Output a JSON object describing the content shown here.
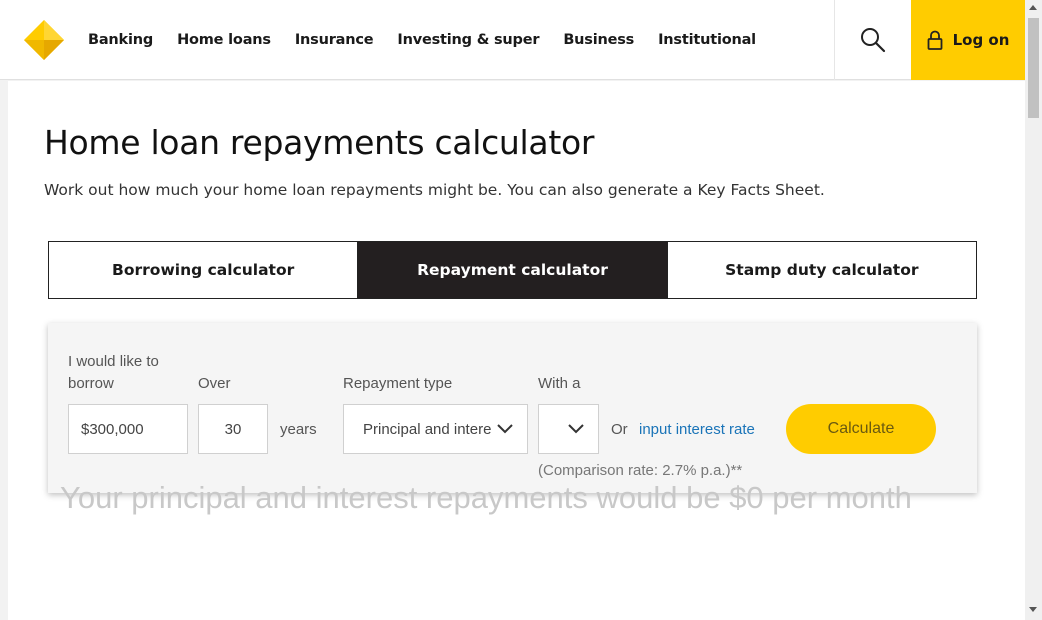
{
  "header": {
    "logo": "commbank-diamond-logo",
    "nav": [
      "Banking",
      "Home loans",
      "Insurance",
      "Investing & super",
      "Business",
      "Institutional"
    ],
    "search_icon": "search-icon",
    "login_label": "Log on",
    "login_icon": "lock-icon",
    "accent": "#ffcc00"
  },
  "page": {
    "title": "Home loan repayments calculator",
    "subtitle": "Work out how much your home loan repayments might be. You can also generate a Key Facts Sheet."
  },
  "tabs": [
    {
      "label": "Borrowing calculator",
      "active": false
    },
    {
      "label": "Repayment calculator",
      "active": true
    },
    {
      "label": "Stamp duty calculator",
      "active": false
    }
  ],
  "calculator": {
    "borrow_label_1": "I would like to",
    "borrow_label_2": "borrow",
    "borrow_value": "$300,000",
    "over_label": "Over",
    "term_value": "30",
    "term_unit": "years",
    "repayment_type_label": "Repayment type",
    "repayment_type_value": "Principal and interest",
    "with_label": "With a",
    "rate_value": "",
    "or_text": "Or",
    "input_rate_link": "input interest rate",
    "comparison_text": "(Comparison rate: 2.7% p.a.)**",
    "calculate_label": "Calculate"
  },
  "result": {
    "text": "Your principal and interest repayments would be $0 per month"
  }
}
